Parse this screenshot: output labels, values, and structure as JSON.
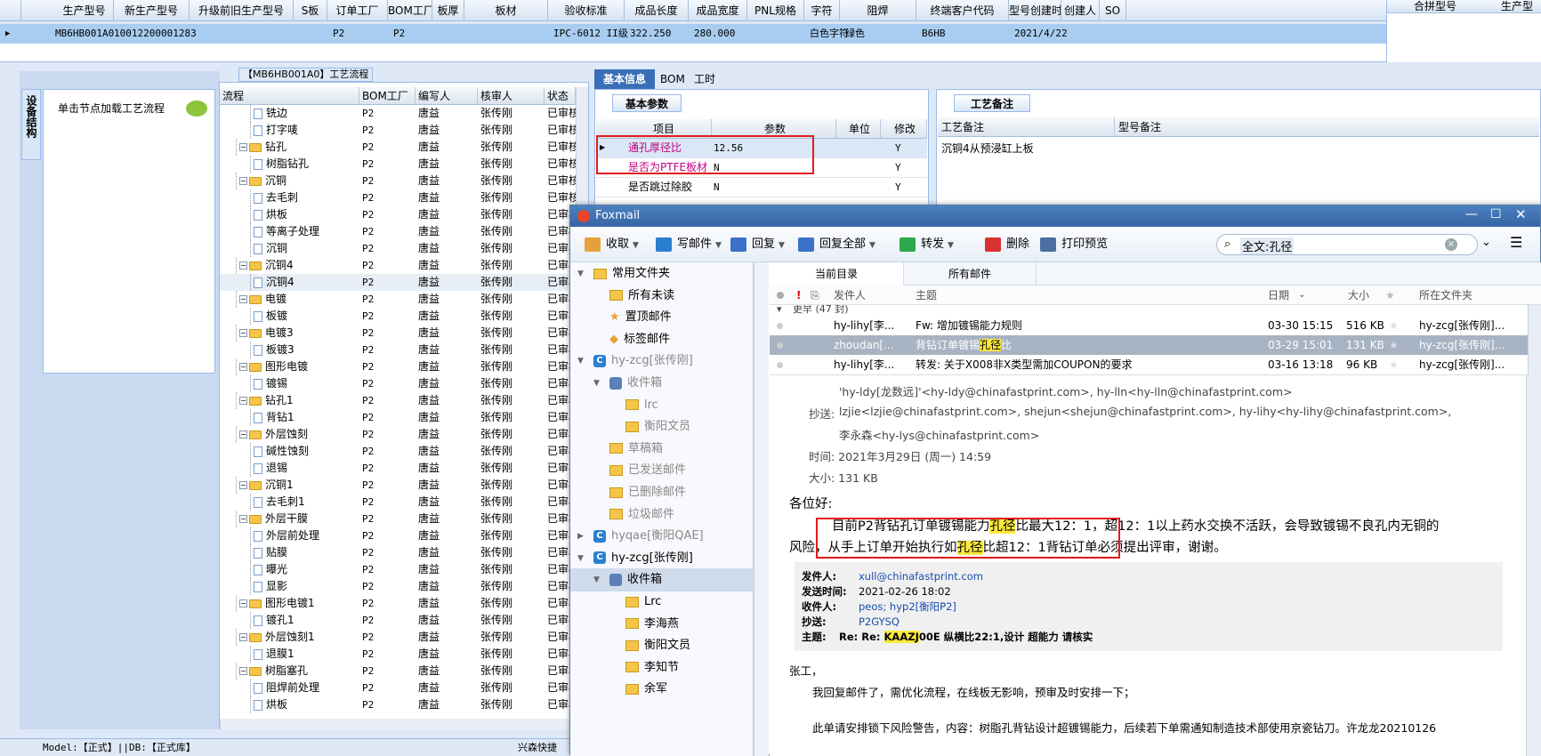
{
  "grid": {
    "columns": [
      "生产型号",
      "新生产型号",
      "升级前旧生产型号",
      "S板",
      "订单工厂",
      "BOM工厂",
      "板厚",
      "板材",
      "验收标准",
      "成品长度",
      "成品宽度",
      "PNL规格",
      "字符",
      "阻焊",
      "终端客户代码",
      "型号创建时间",
      "创建人",
      "SO"
    ],
    "row": [
      "MB6HB001A0",
      "10012200001283",
      "",
      "",
      "P2",
      "P2",
      "",
      "",
      "IPC-6012 II级",
      "322.250",
      "280.000",
      "",
      "白色字符",
      "绿色",
      "B6HB",
      "2021/4/22",
      "",
      ""
    ]
  },
  "right_pane": {
    "col1": "合拼型号",
    "col2": "生产型"
  },
  "flow": {
    "title": "【MB6HB001A0】工艺流程",
    "side_tab": "设备结构",
    "hint": "单击节点加载工艺流程",
    "headers": [
      "流程",
      "BOM工厂",
      "编写人",
      "核审人",
      "状态"
    ],
    "rows": [
      {
        "n": "铣边",
        "t": "doc",
        "f": "P2",
        "w": "唐益",
        "r": "张传刚",
        "s": "已审核"
      },
      {
        "n": "打字唛",
        "t": "doc",
        "f": "P2",
        "w": "唐益",
        "r": "张传刚",
        "s": "已审核"
      },
      {
        "n": "钻孔",
        "t": "folder",
        "f": "P2",
        "w": "唐益",
        "r": "张传刚",
        "s": "已审核"
      },
      {
        "n": "树脂钻孔",
        "t": "doc",
        "f": "P2",
        "w": "唐益",
        "r": "张传刚",
        "s": "已审核"
      },
      {
        "n": "沉铜",
        "t": "folder",
        "f": "P2",
        "w": "唐益",
        "r": "张传刚",
        "s": "已审核"
      },
      {
        "n": "去毛刺",
        "t": "doc",
        "f": "P2",
        "w": "唐益",
        "r": "张传刚",
        "s": "已审核"
      },
      {
        "n": "烘板",
        "t": "doc",
        "f": "P2",
        "w": "唐益",
        "r": "张传刚",
        "s": "已审核"
      },
      {
        "n": "等离子处理",
        "t": "doc",
        "f": "P2",
        "w": "唐益",
        "r": "张传刚",
        "s": "已审核"
      },
      {
        "n": "沉铜",
        "t": "doc",
        "f": "P2",
        "w": "唐益",
        "r": "张传刚",
        "s": "已审核"
      },
      {
        "n": "沉铜4",
        "t": "folder",
        "f": "P2",
        "w": "唐益",
        "r": "张传刚",
        "s": "已审核"
      },
      {
        "n": "沉铜4",
        "t": "doc",
        "f": "P2",
        "w": "唐益",
        "r": "张传刚",
        "s": "已审核"
      },
      {
        "n": "电镀",
        "t": "folder",
        "f": "P2",
        "w": "唐益",
        "r": "张传刚",
        "s": "已审核"
      },
      {
        "n": "板镀",
        "t": "doc",
        "f": "P2",
        "w": "唐益",
        "r": "张传刚",
        "s": "已审核"
      },
      {
        "n": "电镀3",
        "t": "folder",
        "f": "P2",
        "w": "唐益",
        "r": "张传刚",
        "s": "已审核"
      },
      {
        "n": "板镀3",
        "t": "doc",
        "f": "P2",
        "w": "唐益",
        "r": "张传刚",
        "s": "已审核"
      },
      {
        "n": "图形电镀",
        "t": "folder",
        "f": "P2",
        "w": "唐益",
        "r": "张传刚",
        "s": "已审核"
      },
      {
        "n": "镀锡",
        "t": "doc",
        "f": "P2",
        "w": "唐益",
        "r": "张传刚",
        "s": "已审核"
      },
      {
        "n": "钻孔1",
        "t": "folder",
        "f": "P2",
        "w": "唐益",
        "r": "张传刚",
        "s": "已审核"
      },
      {
        "n": "背钻1",
        "t": "doc",
        "f": "P2",
        "w": "唐益",
        "r": "张传刚",
        "s": "已审核"
      },
      {
        "n": "外层蚀刻",
        "t": "folder",
        "f": "P2",
        "w": "唐益",
        "r": "张传刚",
        "s": "已审核"
      },
      {
        "n": "碱性蚀刻",
        "t": "doc",
        "f": "P2",
        "w": "唐益",
        "r": "张传刚",
        "s": "已审核"
      },
      {
        "n": "退锡",
        "t": "doc",
        "f": "P2",
        "w": "唐益",
        "r": "张传刚",
        "s": "已审核"
      },
      {
        "n": "沉铜1",
        "t": "folder",
        "f": "P2",
        "w": "唐益",
        "r": "张传刚",
        "s": "已审核"
      },
      {
        "n": "去毛刺1",
        "t": "doc",
        "f": "P2",
        "w": "唐益",
        "r": "张传刚",
        "s": "已审核"
      },
      {
        "n": "外层干膜",
        "t": "folder",
        "f": "P2",
        "w": "唐益",
        "r": "张传刚",
        "s": "已审核"
      },
      {
        "n": "外层前处理",
        "t": "doc",
        "f": "P2",
        "w": "唐益",
        "r": "张传刚",
        "s": "已审核"
      },
      {
        "n": "贴膜",
        "t": "doc",
        "f": "P2",
        "w": "唐益",
        "r": "张传刚",
        "s": "已审核"
      },
      {
        "n": "曝光",
        "t": "doc",
        "f": "P2",
        "w": "唐益",
        "r": "张传刚",
        "s": "已审核"
      },
      {
        "n": "显影",
        "t": "doc",
        "f": "P2",
        "w": "唐益",
        "r": "张传刚",
        "s": "已审核"
      },
      {
        "n": "图形电镀1",
        "t": "folder",
        "f": "P2",
        "w": "唐益",
        "r": "张传刚",
        "s": "已审核"
      },
      {
        "n": "镀孔1",
        "t": "doc",
        "f": "P2",
        "w": "唐益",
        "r": "张传刚",
        "s": "已审核"
      },
      {
        "n": "外层蚀刻1",
        "t": "folder",
        "f": "P2",
        "w": "唐益",
        "r": "张传刚",
        "s": "已审核"
      },
      {
        "n": "退膜1",
        "t": "doc",
        "f": "P2",
        "w": "唐益",
        "r": "张传刚",
        "s": "已审核"
      },
      {
        "n": "树脂塞孔",
        "t": "folder",
        "f": "P2",
        "w": "唐益",
        "r": "张传刚",
        "s": "已审核"
      },
      {
        "n": "阻焊前处理",
        "t": "doc",
        "f": "P2",
        "w": "唐益",
        "r": "张传刚",
        "s": "已审核"
      },
      {
        "n": "烘板",
        "t": "doc",
        "f": "P2",
        "w": "唐益",
        "r": "张传刚",
        "s": "已审核"
      }
    ]
  },
  "basic": {
    "tabs": [
      "基本信息",
      "BOM",
      "工时"
    ],
    "subtab": "基本参数",
    "headers": [
      "项目",
      "参数",
      "单位",
      "修改"
    ],
    "rows": [
      {
        "item": "通孔厚径比",
        "value": "12.56",
        "unit": "",
        "mod": "Y"
      },
      {
        "item": "是否为PTFE板材",
        "value": "N",
        "unit": "",
        "mod": "Y"
      },
      {
        "item": "是否跳过除胶",
        "value": "N",
        "unit": "",
        "mod": "Y"
      }
    ]
  },
  "remark": {
    "tab": "工艺备注",
    "col1": "工艺备注",
    "col2": "型号备注",
    "value": "沉铜4从预浸缸上板"
  },
  "status": {
    "left": "Model:【正式】||DB:【正式库】",
    "right": "兴森快捷"
  },
  "foxmail": {
    "title": "Foxmail",
    "toolbar": [
      "收取",
      "写邮件",
      "回复",
      "回复全部",
      "转发",
      "删除",
      "打印预览"
    ],
    "search": "全文:孔径",
    "folders": [
      {
        "label": "常用文件夹",
        "indent": 0,
        "type": "folder",
        "arrow": "▼"
      },
      {
        "label": "所有未读",
        "indent": 1,
        "type": "folder",
        "arrow": ""
      },
      {
        "label": "置顶邮件",
        "indent": 1,
        "type": "star",
        "arrow": ""
      },
      {
        "label": "标签邮件",
        "indent": 1,
        "type": "tag",
        "arrow": ""
      },
      {
        "label": "hy-zcg[张传刚]",
        "indent": 0,
        "type": "acct",
        "arrow": "▼",
        "dim": true
      },
      {
        "label": "收件箱",
        "indent": 1,
        "type": "inbox",
        "arrow": "▼",
        "dim": true
      },
      {
        "label": "lrc",
        "indent": 2,
        "type": "folder",
        "arrow": "",
        "dim": true
      },
      {
        "label": "衡阳文员",
        "indent": 2,
        "type": "folder",
        "arrow": "",
        "dim": true
      },
      {
        "label": "草稿箱",
        "indent": 1,
        "type": "folder",
        "arrow": "",
        "dim": true
      },
      {
        "label": "已发送邮件",
        "indent": 1,
        "type": "folder",
        "arrow": "",
        "dim": true
      },
      {
        "label": "已删除邮件",
        "indent": 1,
        "type": "folder",
        "arrow": "",
        "dim": true
      },
      {
        "label": "垃圾邮件",
        "indent": 1,
        "type": "folder",
        "arrow": "",
        "dim": true
      },
      {
        "label": "hyqae[衡阳QAE]",
        "indent": 0,
        "type": "acct",
        "arrow": "▶",
        "dim": true
      },
      {
        "label": "hy-zcg[张传刚]",
        "indent": 0,
        "type": "acct",
        "arrow": "▼"
      },
      {
        "label": "收件箱",
        "indent": 1,
        "type": "inbox",
        "arrow": "▼",
        "selected": true
      },
      {
        "label": "Lrc",
        "indent": 2,
        "type": "folder",
        "arrow": ""
      },
      {
        "label": "李海燕",
        "indent": 2,
        "type": "folder",
        "arrow": ""
      },
      {
        "label": "衡阳文员",
        "indent": 2,
        "type": "folder",
        "arrow": ""
      },
      {
        "label": "李知节",
        "indent": 2,
        "type": "folder",
        "arrow": ""
      },
      {
        "label": "余军",
        "indent": 2,
        "type": "folder",
        "arrow": ""
      }
    ],
    "list_tabs": [
      "当前目录",
      "所有邮件"
    ],
    "list_headers": {
      "from": "发件人",
      "subject": "主题",
      "date": "日期",
      "size": "大小",
      "folder": "所在文件夹"
    },
    "group": "更早 (47 封)",
    "messages": [
      {
        "from": "hy-lihy[李...",
        "s1": "Fw: 增加镀锡能力规则",
        "hl": "",
        "s2": "",
        "date": "03-30 15:15",
        "size": "516 KB",
        "folder": "hy-zcg[张传刚]..."
      },
      {
        "from": "zhoudan[...",
        "s1": "背钻订单镀锡",
        "hl": "孔径",
        "s2": "比",
        "date": "03-29 15:01",
        "size": "131 KB",
        "folder": "hy-zcg[张传刚]..."
      },
      {
        "from": "hy-lihy[李...",
        "s1": "转发: 关于X008非X类型需加COUPON的要求",
        "hl": "",
        "s2": "",
        "date": "03-16 13:18",
        "size": "96 KB",
        "folder": "hy-zcg[张传刚]..."
      }
    ],
    "mail": {
      "to_line": "'hy-ldy[龙数远]'<hy-ldy@chinafastprint.com>, hy-lln<hy-lln@chinafastprint.com>",
      "cc_label": "抄送:",
      "cc": "lzjie<lzjie@chinafastprint.com>, shejun<shejun@chinafastprint.com>, hy-lihy<hy-lihy@chinafastprint.com>,",
      "cc2": "李永森<hy-lys@chinafastprint.com>",
      "time": "时间: 2021年3月29日 (周一) 14:59",
      "size": "大小: 131 KB",
      "greet": "各位好:",
      "b1": "目前P2背钻孔订单镀锡能力",
      "b_hl1": "孔径",
      "b2": "比最大12：1，超12：1以上药水交换不活跃，会导致镀锡不良孔内无铜的",
      "b3": "风险，从手上订单开始执行如",
      "b_hl2": "孔径",
      "b4": "比超12：1背钻订单必须提出评审，谢谢。",
      "q_from_l": "发件人:",
      "q_from": "xull@chinafastprint.com",
      "q_time_l": "发送时间:",
      "q_time": "2021-02-26 18:02",
      "q_to_l": "收件人:",
      "q_to": "peos; hyp2[衡阳P2]",
      "q_cc_l": "抄送:",
      "q_cc": "P2GYSQ",
      "q_sub_l": "主题:",
      "q_sub_pre": "Re: Re: ",
      "q_sub_hl": "KAAZJ",
      "q_sub_post": "00E 纵横比22:1,设计 超能力 请核实",
      "r1": "张工，",
      "r2": "我回复邮件了，需优化流程，在线板无影响，预审及时安排一下；",
      "r3": "此单请安排锁下风险警告，内容：树脂孔背钻设计超镀锡能力，后续若下单需通知制造技术部使用京瓷钻刀。许龙龙20210126"
    }
  }
}
